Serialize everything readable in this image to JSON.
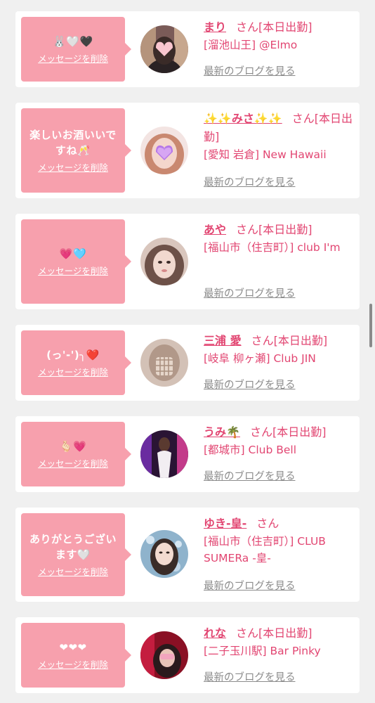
{
  "colors": {
    "page_bg": "#f0f0f0",
    "card_bg": "#ffffff",
    "bubble_bg": "#f7a0ad",
    "accent": "#e24672",
    "link_gray": "#8c8c8c"
  },
  "labels": {
    "delete_message": "メッセージを削除",
    "latest_blog": "最新のブログを見る"
  },
  "entries": [
    {
      "message": "🐰🤍🖤",
      "name": "まり",
      "honorific": "さん",
      "status": "[本日出勤]",
      "shop": "[溜池山王] @Elmo"
    },
    {
      "message": "楽しいお酒いいですね🥂",
      "name": "✨✨みさ✨✨",
      "honorific": "さん",
      "status": "[本日出勤]",
      "shop": "[愛知 岩倉] New Hawaii"
    },
    {
      "message": "💗🩵",
      "name": "あや",
      "honorific": "さん",
      "status": "[本日出勤]",
      "shop": "[福山市（住吉町）] club I'm"
    },
    {
      "message": "(っ'-')╮❤️",
      "name": "三浦 愛",
      "honorific": "さん",
      "status": "[本日出勤]",
      "shop": "[岐阜 柳ヶ瀬] Club JIN"
    },
    {
      "message": "🫰🏻💗",
      "name": "うみ🌴",
      "honorific": "さん",
      "status": "[本日出勤]",
      "shop": "[都城市] Club Bell"
    },
    {
      "message": "ありがとうございます🤍",
      "name": "ゆき-皇-",
      "honorific": "さん",
      "status": "",
      "shop": "[福山市（住吉町）] CLUB SUMERa -皇-"
    },
    {
      "message": "❤❤❤",
      "name": "れな",
      "honorific": "さん",
      "status": "[本日出勤]",
      "shop": "[二子玉川駅] Bar Pinky"
    }
  ]
}
